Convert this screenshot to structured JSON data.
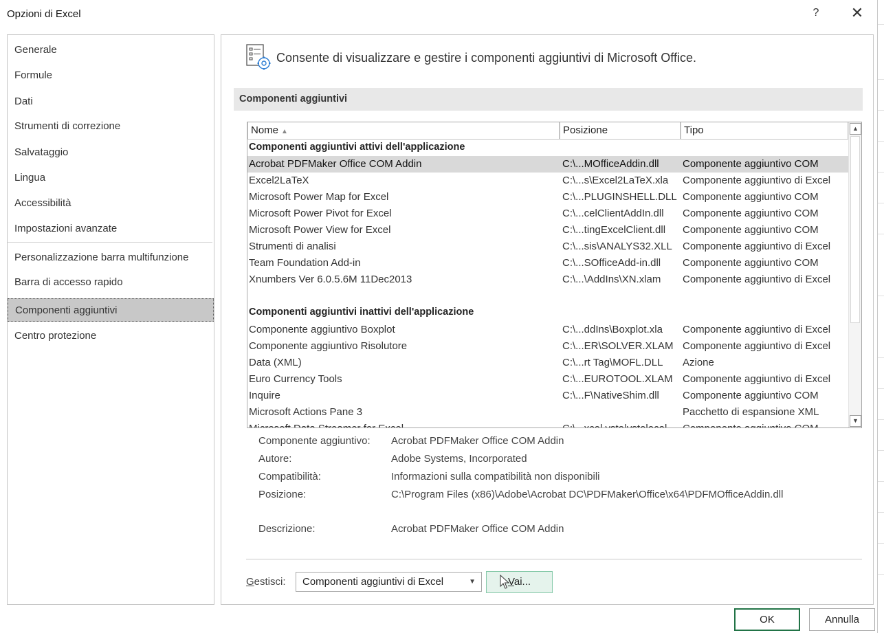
{
  "window": {
    "title": "Opzioni di Excel",
    "help": "?",
    "close": "✕"
  },
  "nav": {
    "items": [
      {
        "label": "Generale"
      },
      {
        "label": "Formule"
      },
      {
        "label": "Dati"
      },
      {
        "label": "Strumenti di correzione"
      },
      {
        "label": "Salvataggio"
      },
      {
        "label": "Lingua"
      },
      {
        "label": "Accessibilità"
      },
      {
        "label": "Impostazioni avanzate"
      },
      {
        "label": "Personalizzazione barra multifunzione"
      },
      {
        "label": "Barra di accesso rapido"
      },
      {
        "label": "Componenti aggiuntivi"
      },
      {
        "label": "Centro protezione"
      }
    ],
    "selected": "Componenti aggiuntivi"
  },
  "header": {
    "description": "Consente di visualizzare e gestire i componenti aggiuntivi di Microsoft Office.",
    "section_title": "Componenti aggiuntivi"
  },
  "table": {
    "columns": [
      "Nome",
      "Posizione",
      "Tipo"
    ],
    "sort_indicator": "▲",
    "active_group": "Componenti aggiuntivi attivi dell'applicazione",
    "active_rows": [
      [
        "Acrobat PDFMaker Office COM Addin",
        "C:\\...MOfficeAddin.dll",
        "Componente aggiuntivo COM"
      ],
      [
        "Excel2LaTeX",
        "C:\\...s\\Excel2LaTeX.xla",
        "Componente aggiuntivo di Excel"
      ],
      [
        "Microsoft Power Map for Excel",
        "C:\\...PLUGINSHELL.DLL",
        "Componente aggiuntivo COM"
      ],
      [
        "Microsoft Power Pivot for Excel",
        "C:\\...celClientAddIn.dll",
        "Componente aggiuntivo COM"
      ],
      [
        "Microsoft Power View for Excel",
        "C:\\...tingExcelClient.dll",
        "Componente aggiuntivo COM"
      ],
      [
        "Strumenti di analisi",
        "C:\\...sis\\ANALYS32.XLL",
        "Componente aggiuntivo di Excel"
      ],
      [
        "Team Foundation Add-in",
        "C:\\...SOfficeAdd-in.dll",
        "Componente aggiuntivo COM"
      ],
      [
        "Xnumbers Ver 6.0.5.6M 11Dec2013",
        "C:\\...\\AddIns\\XN.xlam",
        "Componente aggiuntivo di Excel"
      ]
    ],
    "inactive_group": "Componenti aggiuntivi inattivi dell'applicazione",
    "inactive_rows": [
      [
        "Componente aggiuntivo Boxplot",
        "C:\\...ddIns\\Boxplot.xla",
        "Componente aggiuntivo di Excel"
      ],
      [
        "Componente aggiuntivo Risolutore",
        "C:\\...ER\\SOLVER.XLAM",
        "Componente aggiuntivo di Excel"
      ],
      [
        "Data (XML)",
        "C:\\...rt Tag\\MOFL.DLL",
        "Azione"
      ],
      [
        "Euro Currency Tools",
        "C:\\...EUROTOOL.XLAM",
        "Componente aggiuntivo di Excel"
      ],
      [
        "Inquire",
        "C:\\...F\\NativeShim.dll",
        "Componente aggiuntivo COM"
      ],
      [
        "Microsoft Actions Pane 3",
        "",
        "Pacchetto di espansione XML"
      ],
      [
        "Microsoft Data Streamer for Excel",
        "C:\\...xcel.vsto|vstolocal",
        "Componente aggiuntivo COM"
      ]
    ]
  },
  "details": {
    "addin_label": "Componente aggiuntivo:",
    "addin_value": "Acrobat PDFMaker Office COM Addin",
    "author_label": "Autore:",
    "author_value": "Adobe Systems, Incorporated",
    "compat_label": "Compatibilità:",
    "compat_value": "Informazioni sulla compatibilità non disponibili",
    "location_label": "Posizione:",
    "location_value": "C:\\Program Files (x86)\\Adobe\\Acrobat DC\\PDFMaker\\Office\\x64\\PDFMOfficeAddin.dll",
    "description_label": "Descrizione:",
    "description_value": "Acrobat PDFMaker Office COM Addin"
  },
  "manage": {
    "label_underlined": "G",
    "label_rest": "estisci:",
    "selected": "Componenti aggiuntivi di Excel",
    "go_underlined": "V",
    "go_rest": "ai..."
  },
  "buttons": {
    "ok": "OK",
    "cancel": "Annulla"
  },
  "colors": {
    "selected_nav": "#c8c8c8",
    "go_button_bg": "#e5f3ec",
    "ok_border": "#217346"
  }
}
